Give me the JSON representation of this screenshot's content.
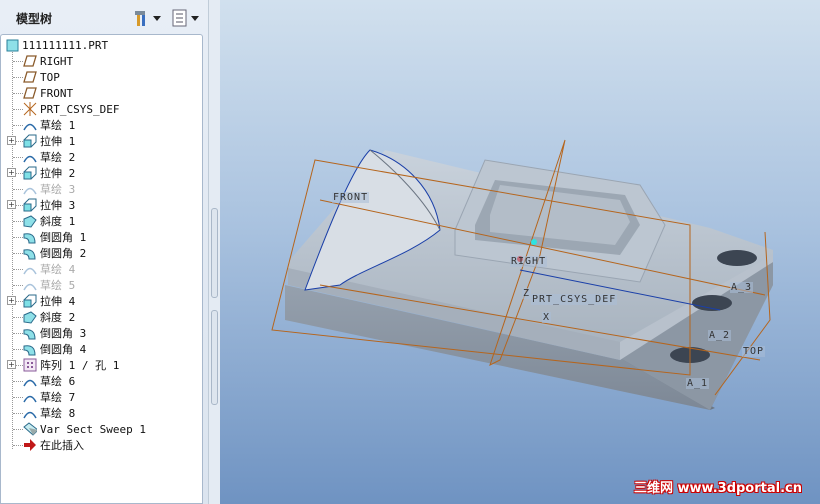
{
  "panel": {
    "title": "模型树",
    "tools_icon": "hammer-icon",
    "settings_icon": "list-icon"
  },
  "tree": {
    "root": "111111111.PRT",
    "items": [
      {
        "label": "RIGHT",
        "icon": "datum-plane",
        "expand": false,
        "dim": false
      },
      {
        "label": "TOP",
        "icon": "datum-plane",
        "expand": false,
        "dim": false
      },
      {
        "label": "FRONT",
        "icon": "datum-plane",
        "expand": false,
        "dim": false
      },
      {
        "label": "PRT_CSYS_DEF",
        "icon": "csys",
        "expand": false,
        "dim": false
      },
      {
        "label": "草绘 1",
        "icon": "sketch",
        "expand": false,
        "dim": false
      },
      {
        "label": "拉伸 1",
        "icon": "extrude",
        "expand": true,
        "dim": false
      },
      {
        "label": "草绘 2",
        "icon": "sketch",
        "expand": false,
        "dim": false
      },
      {
        "label": "拉伸 2",
        "icon": "extrude",
        "expand": true,
        "dim": false
      },
      {
        "label": "草绘 3",
        "icon": "sketch",
        "expand": false,
        "dim": true
      },
      {
        "label": "拉伸 3",
        "icon": "extrude",
        "expand": true,
        "dim": false
      },
      {
        "label": "斜度 1",
        "icon": "draft",
        "expand": false,
        "dim": false
      },
      {
        "label": "倒圆角 1",
        "icon": "round",
        "expand": false,
        "dim": false
      },
      {
        "label": "倒圆角 2",
        "icon": "round",
        "expand": false,
        "dim": false
      },
      {
        "label": "草绘 4",
        "icon": "sketch",
        "expand": false,
        "dim": true
      },
      {
        "label": "草绘 5",
        "icon": "sketch",
        "expand": false,
        "dim": true
      },
      {
        "label": "拉伸 4",
        "icon": "extrude",
        "expand": true,
        "dim": false
      },
      {
        "label": "斜度 2",
        "icon": "draft",
        "expand": false,
        "dim": false
      },
      {
        "label": "倒圆角 3",
        "icon": "round",
        "expand": false,
        "dim": false
      },
      {
        "label": "倒圆角 4",
        "icon": "round",
        "expand": false,
        "dim": false
      },
      {
        "label": "阵列 1 / 孔 1",
        "icon": "pattern",
        "expand": true,
        "dim": false
      },
      {
        "label": "草绘 6",
        "icon": "sketch",
        "expand": false,
        "dim": false
      },
      {
        "label": "草绘 7",
        "icon": "sketch",
        "expand": false,
        "dim": false
      },
      {
        "label": "草绘 8",
        "icon": "sketch",
        "expand": false,
        "dim": false
      },
      {
        "label": "Var Sect Sweep 1",
        "icon": "sweep",
        "expand": false,
        "dim": false
      },
      {
        "label": "在此插入",
        "icon": "insert-arrow",
        "expand": false,
        "dim": false
      }
    ]
  },
  "viewport": {
    "labels": {
      "front": "FRONT",
      "right": "RIGHT",
      "csys": "PRT_CSYS_DEF",
      "z": "Z",
      "x": "X",
      "top": "TOP",
      "a1": "A_1",
      "a2": "A_2",
      "a3": "A_3"
    },
    "watermark": "三维网 www.3dportal.cn"
  }
}
